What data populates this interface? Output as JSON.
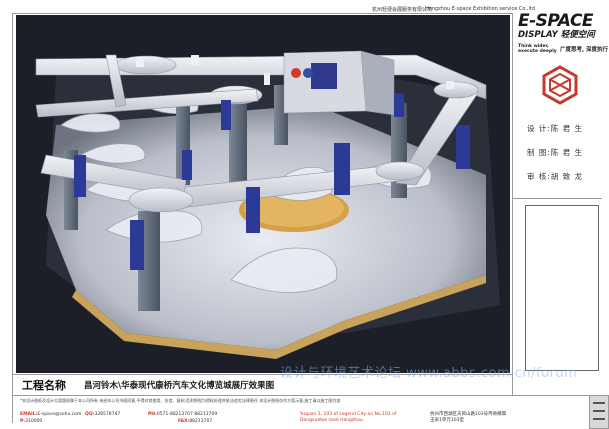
{
  "header": {
    "company_cn": "杭州轻便会展服务有限公司",
    "company_en": "Hangzhou E-space Exhibition service Co.,ltd"
  },
  "brand": {
    "logo_main": "E-SPACE",
    "logo_sub": "DISPLAY 轻便空间",
    "tagline_en": "Think wider, execute deeply",
    "tagline_cn": "广度思考, 深度执行",
    "accent_color": "#c23a2b"
  },
  "credits": {
    "design": "设 计:陈 君 生",
    "drawing": "制 图:陈 君 生",
    "review": "审 核:胡 致 龙"
  },
  "project": {
    "label": "工程名称",
    "name": "昌河铃木\\华泰现代康桥汽车文化博览城展厅效果图"
  },
  "watermark": "设计与环境艺术论坛 www.abbs.com.cn/forum",
  "footer": {
    "notice": "*本设计图纸及设计方案版权属于本公司所有 未经本公司书面同意,不得对其使用、仿造、复制;否则将视为侵权处理并依法追究法律责任 本设计图纸仅作方案示意,施工请以施工图为准",
    "email": "E-space@sohu.com",
    "email_label": "EMAIL:",
    "qq": "328578747",
    "qq_label": "QQ:",
    "postcode": "310000",
    "postcode_label": "P:",
    "phone": "0571-88213707 88213709",
    "phone_label": "PH:",
    "fax": "88213707",
    "fax_label": "FAX:",
    "address_en": "Yuquan 1, 103 of Legend City on No.103 of Dongxuebei road Hangzhou",
    "address_cn": "杭州市西湖区天目山路103号传奇精典 玉泉1单元103室"
  }
}
